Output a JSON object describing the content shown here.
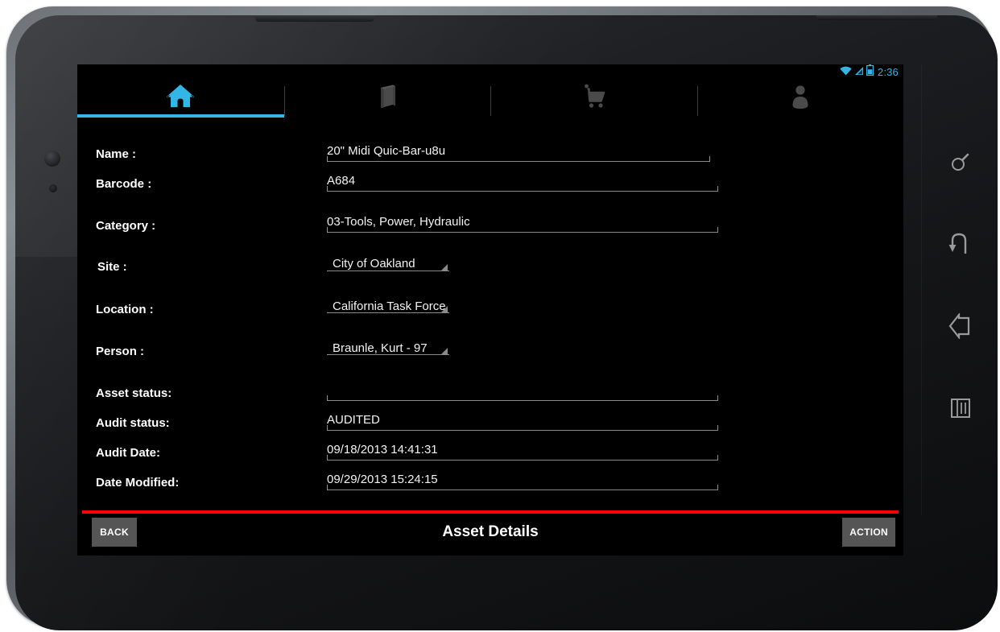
{
  "status_bar": {
    "clock": "2:36",
    "icons": [
      "wifi-icon",
      "signal-icon",
      "battery-icon"
    ],
    "accent_color": "#33b5e5"
  },
  "tabs": [
    {
      "id": "tab-home",
      "icon": "home-icon",
      "label": "Home",
      "active": true
    },
    {
      "id": "tab-catalog",
      "icon": "book-icon",
      "label": "Catalog",
      "active": false
    },
    {
      "id": "tab-cart",
      "icon": "cart-icon",
      "label": "Cart",
      "active": false
    },
    {
      "id": "tab-person",
      "icon": "person-icon",
      "label": "Person",
      "active": false
    }
  ],
  "form": {
    "fields": [
      {
        "label": "Name :",
        "value": "20\" Midi Quic-Bar-u8u",
        "type": "text"
      },
      {
        "label": "Barcode :",
        "value": "A684",
        "type": "text"
      },
      {
        "label": "Category :",
        "value": "03-Tools, Power, Hydraulic",
        "type": "text"
      },
      {
        "label": "Site :",
        "value": "City of Oakland",
        "type": "spinner"
      },
      {
        "label": "Location :",
        "value": "California Task Force",
        "type": "spinner"
      },
      {
        "label": "Person :",
        "value": "Braunle, Kurt - 97",
        "type": "spinner"
      },
      {
        "label": "Asset status:",
        "value": "",
        "type": "text"
      },
      {
        "label": "Audit status:",
        "value": "AUDITED",
        "type": "text"
      },
      {
        "label": "Audit Date:",
        "value": "09/18/2013 14:41:31",
        "type": "text"
      },
      {
        "label": "Date Modified:",
        "value": "09/29/2013 15:24:15",
        "type": "text"
      }
    ]
  },
  "bottom_bar": {
    "back_label": "BACK",
    "title": "Asset Details",
    "action_label": "ACTION",
    "separator_color": "#ff0000",
    "button_color": "#555555"
  },
  "navbar": {
    "keys": [
      {
        "id": "nav-search",
        "icon": "search-icon"
      },
      {
        "id": "nav-back",
        "icon": "back-arrow-icon"
      },
      {
        "id": "nav-home",
        "icon": "home-outline-icon"
      },
      {
        "id": "nav-recents",
        "icon": "recents-icon"
      }
    ]
  }
}
